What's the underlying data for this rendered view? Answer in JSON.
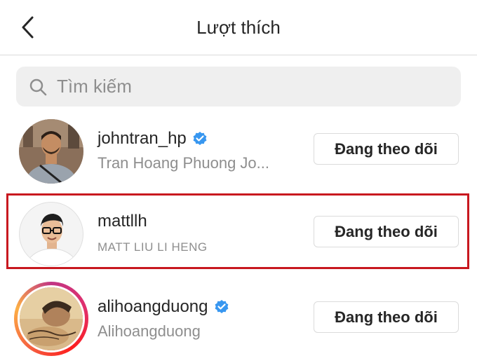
{
  "header": {
    "title": "Lượt thích"
  },
  "search": {
    "placeholder": "Tìm kiếm"
  },
  "users": [
    {
      "username": "johntran_hp",
      "full_name": "Tran Hoang Phuong Jo...",
      "verified": true,
      "follow_label": "Đang theo dõi"
    },
    {
      "username": "mattllh",
      "full_name": "MATT LIU LI HENG",
      "verified": false,
      "follow_label": "Đang theo dõi"
    },
    {
      "username": "alihoangduong",
      "full_name": "Alihoangduong",
      "verified": true,
      "follow_label": "Đang theo dõi"
    }
  ],
  "colors": {
    "verified": "#3897f0",
    "highlight": "#c8181f",
    "secondary_text": "#8e8e8e"
  }
}
